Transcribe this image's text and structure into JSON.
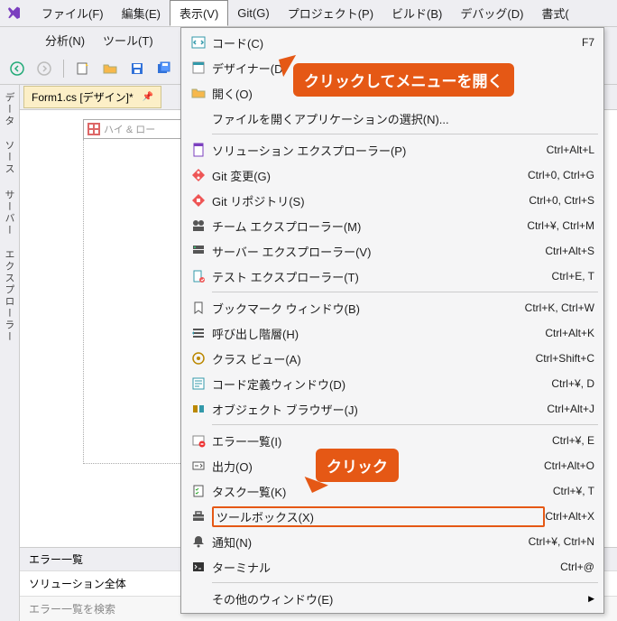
{
  "menubar": {
    "items": [
      "ファイル(F)",
      "編集(E)",
      "表示(V)",
      "Git(G)",
      "プロジェクト(P)",
      "ビルド(B)",
      "デバッグ(D)",
      "書式("
    ],
    "row2": [
      "分析(N)",
      "ツール(T)"
    ],
    "active_index": 2
  },
  "vtabs": {
    "a": "データ ソース",
    "b": "サーバー エクスプローラー"
  },
  "doctab": {
    "title": "Form1.cs [デザイン]*"
  },
  "designer": {
    "formcaption": "ハイ & ロー"
  },
  "menu": {
    "items": [
      {
        "icon": "code",
        "label": "コード(C)",
        "shortcut": "F7"
      },
      {
        "icon": "designer",
        "label": "デザイナー(D)",
        "shortcut": ""
      },
      {
        "icon": "open",
        "label": "開く(O)",
        "shortcut": ""
      },
      {
        "icon": "",
        "label": "ファイルを開くアプリケーションの選択(N)...",
        "shortcut": ""
      },
      {
        "sep": true
      },
      {
        "icon": "solution",
        "label": "ソリューション エクスプローラー(P)",
        "shortcut": "Ctrl+Alt+L"
      },
      {
        "icon": "git",
        "label": "Git 変更(G)",
        "shortcut": "Ctrl+0, Ctrl+G"
      },
      {
        "icon": "gitrepo",
        "label": "Git リポジトリ(S)",
        "shortcut": "Ctrl+0, Ctrl+S"
      },
      {
        "icon": "team",
        "label": "チーム エクスプローラー(M)",
        "shortcut": "Ctrl+¥, Ctrl+M"
      },
      {
        "icon": "server",
        "label": "サーバー エクスプローラー(V)",
        "shortcut": "Ctrl+Alt+S"
      },
      {
        "icon": "test",
        "label": "テスト エクスプローラー(T)",
        "shortcut": "Ctrl+E, T"
      },
      {
        "sep": true
      },
      {
        "icon": "bookmark",
        "label": "ブックマーク ウィンドウ(B)",
        "shortcut": "Ctrl+K, Ctrl+W"
      },
      {
        "icon": "callstack",
        "label": "呼び出し階層(H)",
        "shortcut": "Ctrl+Alt+K"
      },
      {
        "icon": "classview",
        "label": "クラス ビュー(A)",
        "shortcut": "Ctrl+Shift+C"
      },
      {
        "icon": "codedef",
        "label": "コード定義ウィンドウ(D)",
        "shortcut": "Ctrl+¥, D"
      },
      {
        "icon": "objbrowser",
        "label": "オブジェクト ブラウザー(J)",
        "shortcut": "Ctrl+Alt+J"
      },
      {
        "sep": true
      },
      {
        "icon": "error",
        "label": "エラー一覧(I)",
        "shortcut": "Ctrl+¥, E"
      },
      {
        "icon": "output",
        "label": "出力(O)",
        "shortcut": "Ctrl+Alt+O"
      },
      {
        "icon": "task",
        "label": "タスク一覧(K)",
        "shortcut": "Ctrl+¥, T"
      },
      {
        "icon": "toolbox",
        "label": "ツールボックス(X)",
        "shortcut": "Ctrl+Alt+X",
        "hilite": true
      },
      {
        "icon": "notif",
        "label": "通知(N)",
        "shortcut": "Ctrl+¥, Ctrl+N"
      },
      {
        "icon": "terminal",
        "label": "ターミナル",
        "shortcut": "Ctrl+@"
      },
      {
        "sep": true
      },
      {
        "icon": "",
        "label": "その他のウィンドウ(E)",
        "shortcut": "",
        "submenu": true
      }
    ]
  },
  "errorpane": {
    "title": "エラー一覧",
    "subtitle": "ソリューション全体",
    "search_placeholder": "エラー一覧を検索"
  },
  "callouts": {
    "open_menu": "クリックしてメニューを開く",
    "click": "クリック"
  }
}
